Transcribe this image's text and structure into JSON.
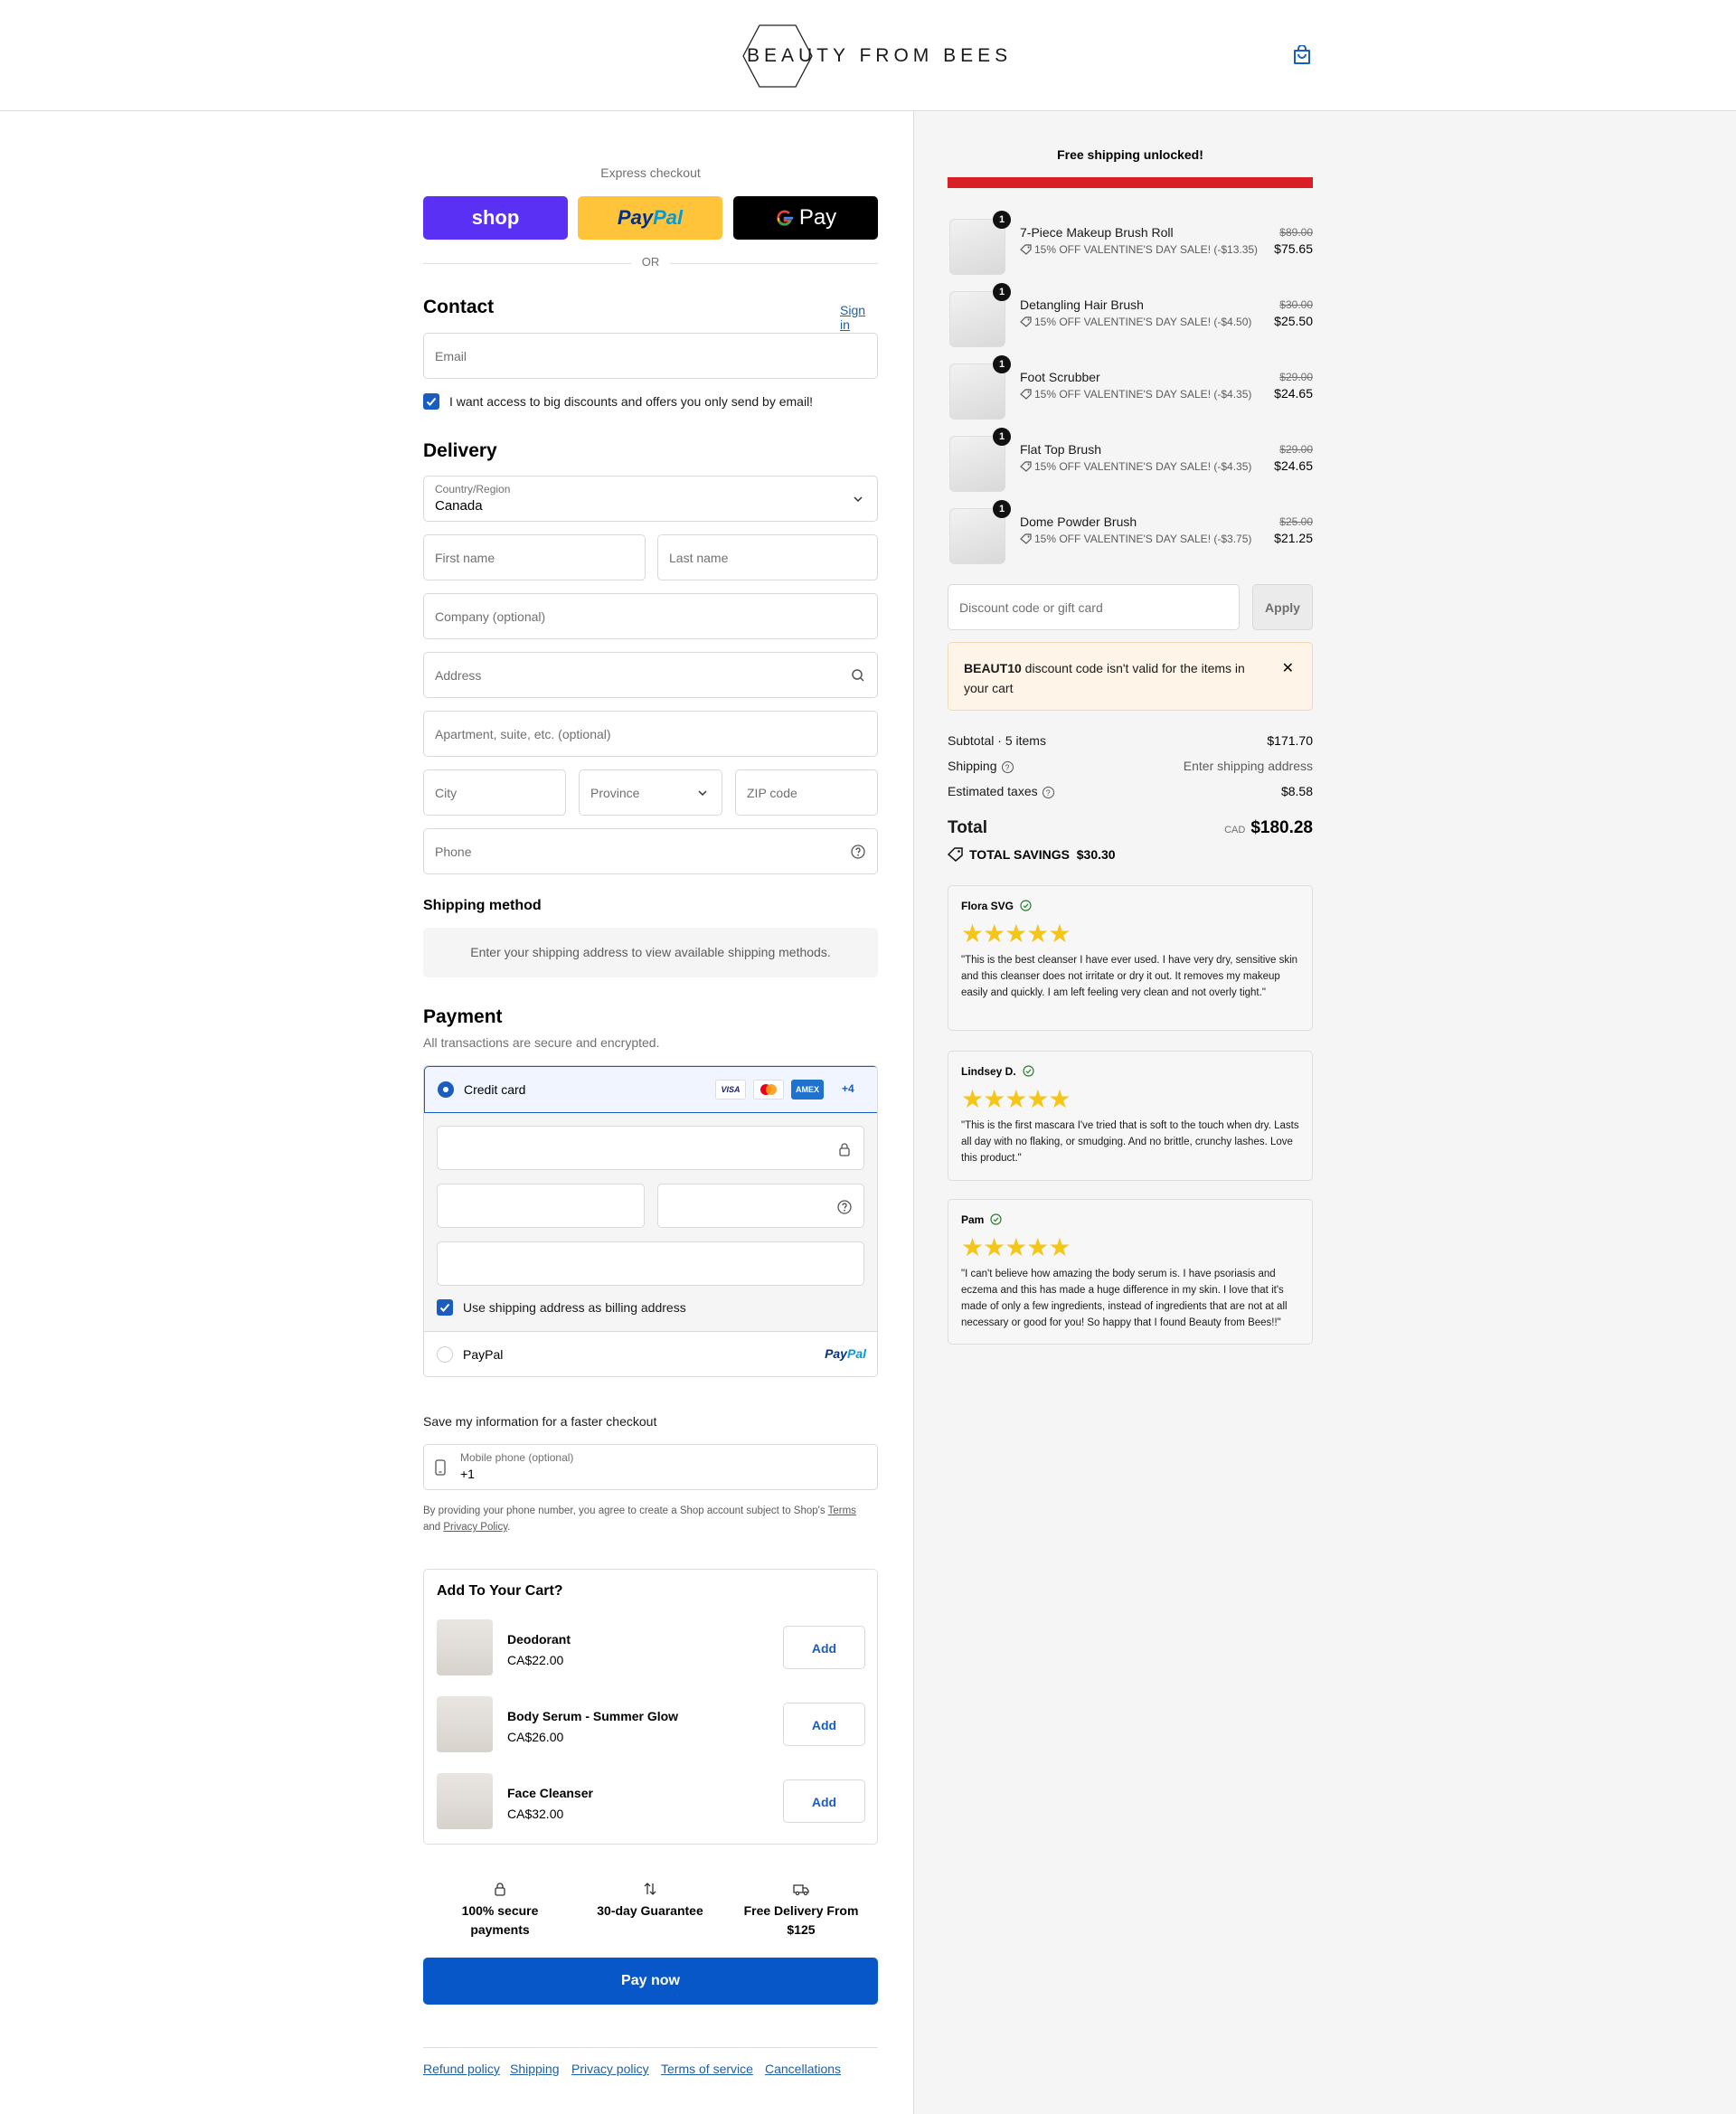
{
  "header": {
    "brand": "BEAUTY FROM BEES"
  },
  "express": {
    "label": "Express checkout",
    "shop": "shop",
    "paypal_1": "Pay",
    "paypal_2": "Pal",
    "gpay": "Pay",
    "or": "OR"
  },
  "contact": {
    "title": "Contact",
    "sign_in": "Sign in",
    "email_placeholder": "Email",
    "marketing_label": "I want access to big discounts and offers you only send by email!"
  },
  "delivery": {
    "title": "Delivery",
    "country_label": "Country/Region",
    "country_value": "Canada",
    "first_name": "First name",
    "last_name": "Last name",
    "company": "Company (optional)",
    "address": "Address",
    "apartment": "Apartment, suite, etc. (optional)",
    "city": "City",
    "province": "Province",
    "zip": "ZIP code",
    "phone": "Phone"
  },
  "shipping_method": {
    "title": "Shipping method",
    "message": "Enter your shipping address to view available shipping methods."
  },
  "payment": {
    "title": "Payment",
    "subtitle": "All transactions are secure and encrypted.",
    "credit_card": "Credit card",
    "visa": "VISA",
    "amex": "AMEX",
    "more": "+4",
    "billing_label": "Use shipping address as billing address",
    "paypal": "PayPal",
    "paypal_logo_1": "Pay",
    "paypal_logo_2": "Pal"
  },
  "save_info": {
    "title": "Save my information for a faster checkout",
    "mobile_label": "Mobile phone (optional)",
    "mobile_value": "+1",
    "disclaimer_1": "By providing your phone number, you agree to create a Shop account subject to Shop's",
    "terms": "Terms",
    "and": "and",
    "privacy": "Privacy Policy",
    "period": "."
  },
  "upsell": {
    "title": "Add To Your Cart?",
    "add_label": "Add",
    "items": [
      {
        "name": "Deodorant",
        "price": "CA$22.00"
      },
      {
        "name": "Body Serum - Summer Glow",
        "price": "CA$26.00"
      },
      {
        "name": "Face Cleanser",
        "price": "CA$32.00"
      }
    ]
  },
  "trust": {
    "secure_1": "100% secure",
    "secure_2": "payments",
    "guarantee": "30-day Guarantee",
    "delivery_1": "Free Delivery From",
    "delivery_2": "$125"
  },
  "pay_now": "Pay now",
  "footer": {
    "refund": "Refund policy",
    "shipping": "Shipping",
    "privacy": "Privacy policy",
    "terms": "Terms of service",
    "cancellations": "Cancellations"
  },
  "summary": {
    "free_shipping": "Free shipping unlocked!",
    "free_shipping_progress": 1.0,
    "items": [
      {
        "qty": "1",
        "name": "7-Piece Makeup Brush Roll",
        "discount": "15% OFF VALENTINE'S DAY SALE! (-$13.35)",
        "old": "$89.00",
        "price": "$75.65"
      },
      {
        "qty": "1",
        "name": "Detangling Hair Brush",
        "discount": "15% OFF VALENTINE'S DAY SALE! (-$4.50)",
        "old": "$30.00",
        "price": "$25.50"
      },
      {
        "qty": "1",
        "name": "Foot Scrubber",
        "discount": "15% OFF VALENTINE'S DAY SALE! (-$4.35)",
        "old": "$29.00",
        "price": "$24.65"
      },
      {
        "qty": "1",
        "name": "Flat Top Brush",
        "discount": "15% OFF VALENTINE'S DAY SALE! (-$4.35)",
        "old": "$29.00",
        "price": "$24.65"
      },
      {
        "qty": "1",
        "name": "Dome Powder Brush",
        "discount": "15% OFF VALENTINE'S DAY SALE! (-$3.75)",
        "old": "$25.00",
        "price": "$21.25"
      }
    ],
    "discount_placeholder": "Discount code or gift card",
    "apply": "Apply",
    "warning_code": "BEAUT10",
    "warning_text": " discount code isn't valid for the items in your cart",
    "subtotal_label": "Subtotal · 5 items",
    "subtotal_value": "$171.70",
    "shipping_label": "Shipping",
    "shipping_value": "Enter shipping address",
    "taxes_label": "Estimated taxes",
    "taxes_value": "$8.58",
    "total_label": "Total",
    "currency": "CAD",
    "total_value": "$180.28",
    "savings_label": "TOTAL SAVINGS",
    "savings_value": "$30.30"
  },
  "reviews": [
    {
      "name": "Flora SVG",
      "stars": "★★★★★",
      "text": "\"This is the best cleanser I have ever used. I have very dry, sensitive skin and this cleanser does not irritate or dry it out. It removes my makeup easily and quickly. I am left feeling very clean and not overly tight.\""
    },
    {
      "name": "Lindsey D.",
      "stars": "★★★★★",
      "text": "\"This is the first mascara I've tried that is soft to the touch when dry. Lasts all day with no flaking, or smudging. And no brittle, crunchy lashes. Love this product.\""
    },
    {
      "name": "Pam",
      "stars": "★★★★★",
      "text": "\"I can't believe how amazing the body serum is. I have psoriasis and eczema and this has made a huge difference in my skin. I love that it's made of only a few ingredients, instead of ingredients that are not at all necessary or good for you! So happy that I found Beauty from Bees!!\""
    }
  ]
}
